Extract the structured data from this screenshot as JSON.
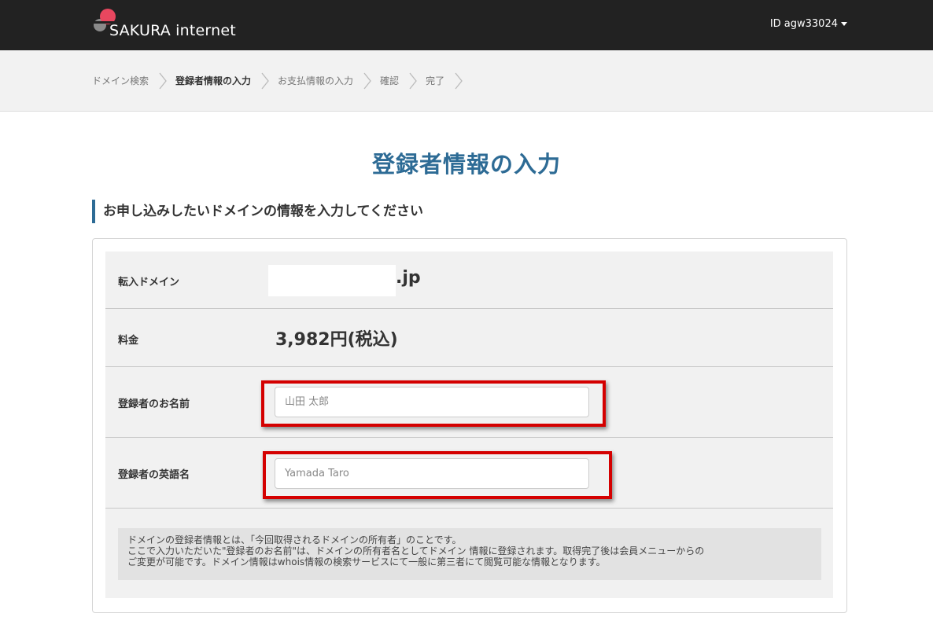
{
  "header": {
    "logo_text": "SAKURA internet",
    "user_id": "ID agw33024",
    "logo_colors": {
      "accent": "#e8475f",
      "shadow": "#8a8a8a"
    }
  },
  "steps": [
    {
      "label": "ドメイン検索",
      "active": false
    },
    {
      "label": "登録者情報の入力",
      "active": true
    },
    {
      "label": "お支払情報の入力",
      "active": false
    },
    {
      "label": "確認",
      "active": false
    },
    {
      "label": "完了",
      "active": false
    }
  ],
  "page": {
    "title": "登録者情報の入力",
    "section_heading": "お申し込みしたいドメインの情報を入力してください"
  },
  "form": {
    "domain": {
      "label": "転入ドメイン",
      "suffix": ".jp"
    },
    "price": {
      "label": "料金",
      "value": "3,982円(税込)"
    },
    "registrant_name": {
      "label": "登録者のお名前",
      "placeholder": "山田 太郎",
      "value": ""
    },
    "registrant_name_en": {
      "label": "登録者の英語名",
      "placeholder": "Yamada Taro",
      "value": ""
    }
  },
  "note": {
    "lines": [
      "ドメインの登録者情報とは、「今回取得されるドメインの所有者」のことです。",
      "ここで入力いただいた\"登録者のお名前\"は、ドメインの所有者名としてドメイン 情報に登録されます。取得完了後は会員メニューからの",
      "ご変更が可能です。ドメイン情報はwhois情報の検索サービスにて一般に第三者にて閲覧可能な情報となります。"
    ]
  },
  "colors": {
    "header_bg": "#222222",
    "title": "#2d6b95",
    "highlight": "#d40000"
  }
}
